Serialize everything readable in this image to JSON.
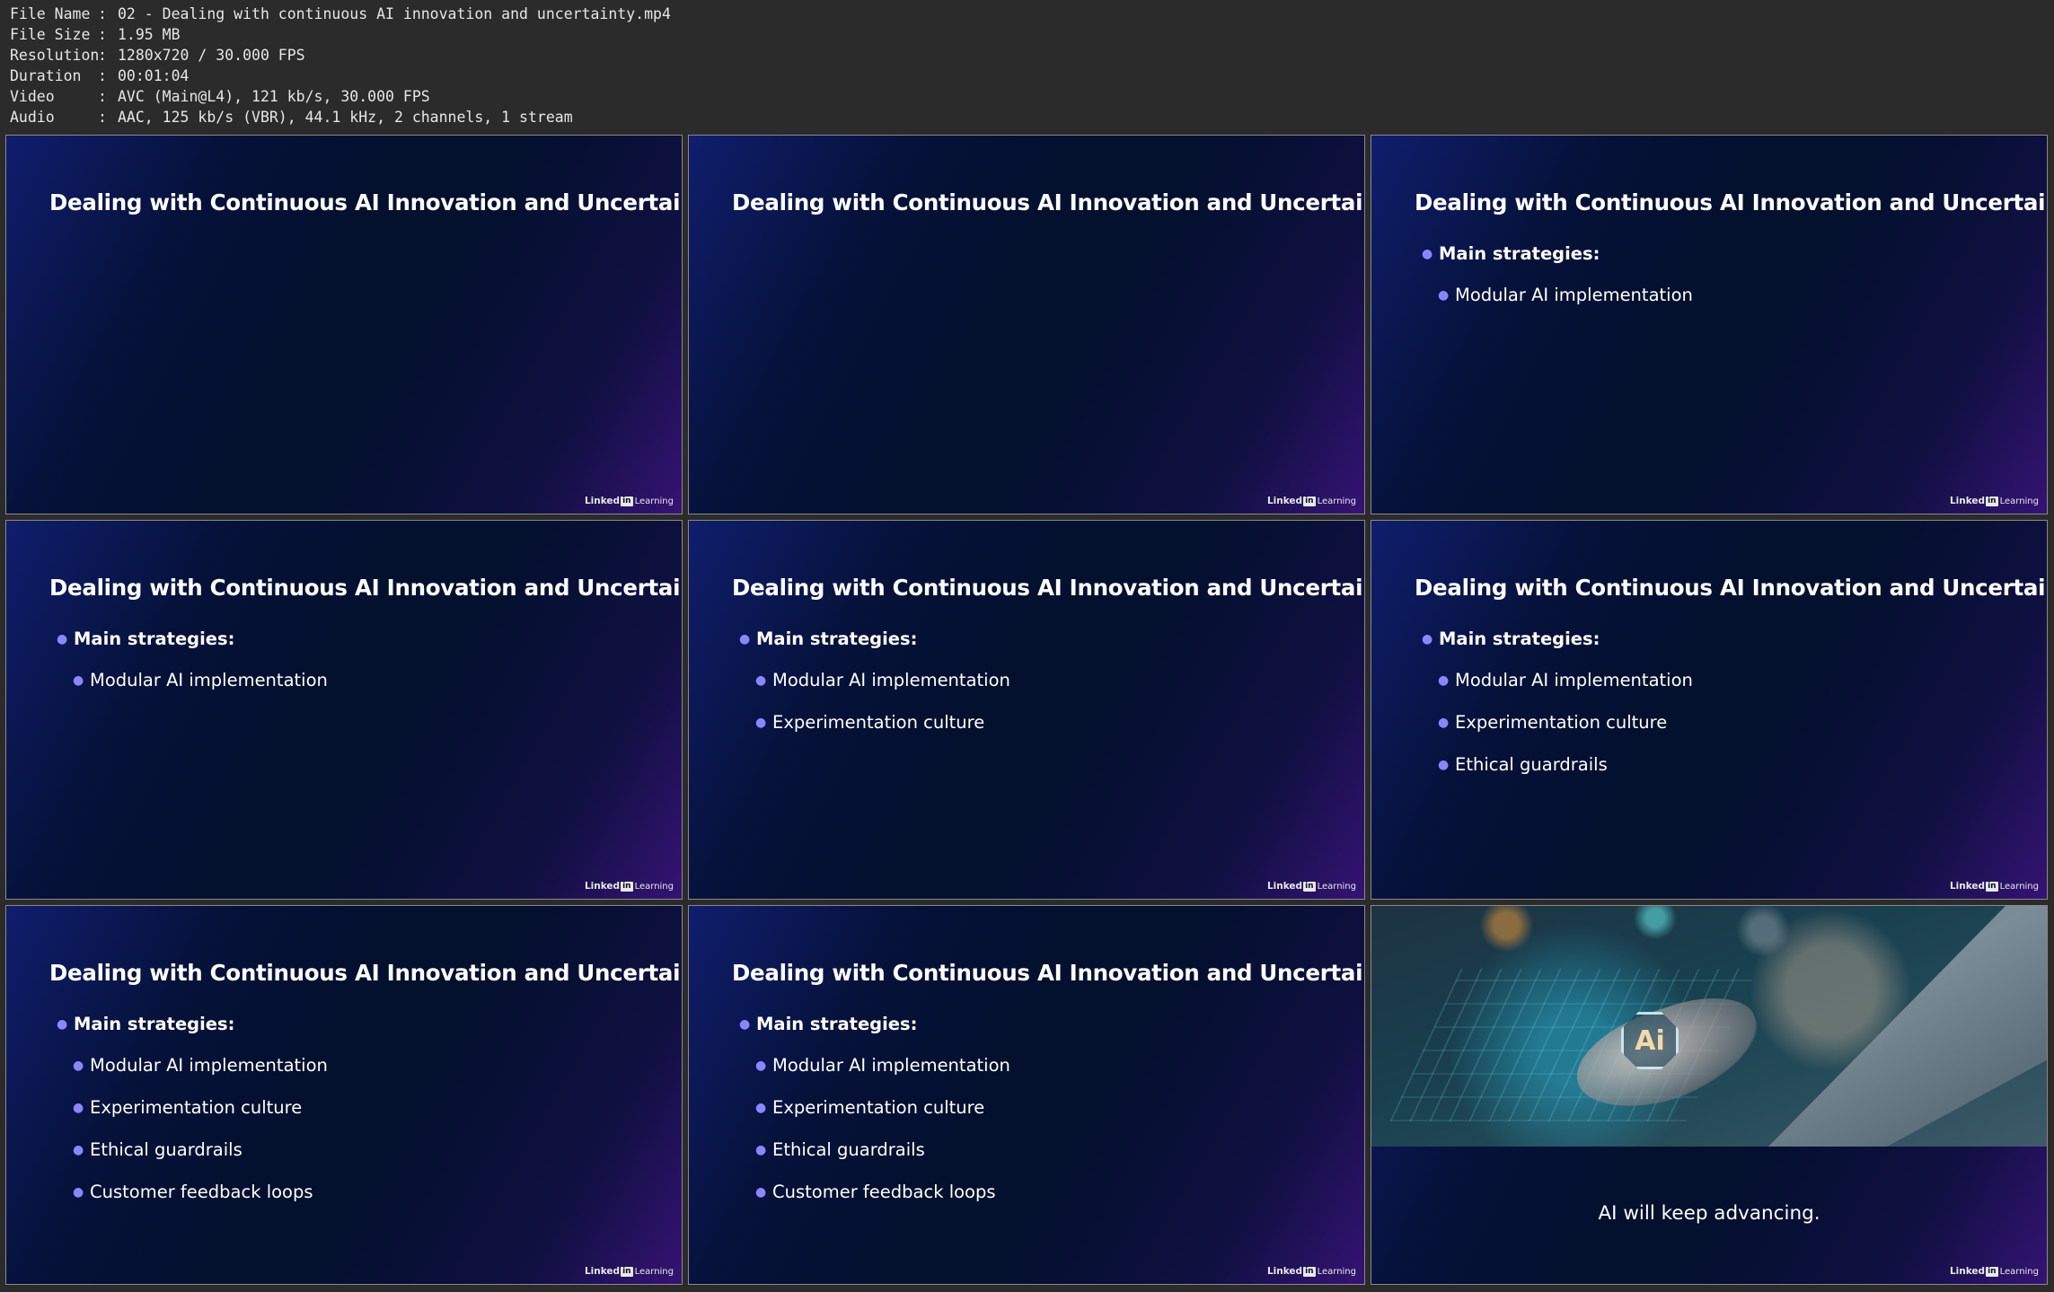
{
  "file_info": [
    {
      "key": "File Name",
      "value": "02 - Dealing with continuous AI innovation and uncertainty.mp4"
    },
    {
      "key": "File Size",
      "value": "1.95 MB"
    },
    {
      "key": "Resolution",
      "value": "1280x720 / 30.000 FPS"
    },
    {
      "key": "Duration",
      "value": "00:01:04"
    },
    {
      "key": "Video",
      "value": "AVC (Main@L4), 121 kb/s, 30.000 FPS"
    },
    {
      "key": "Audio",
      "value": "AAC, 125 kb/s (VBR), 44.1 kHz, 2 channels, 1 stream"
    }
  ],
  "separator": ":",
  "slide_title": "Dealing with Continuous AI Innovation and Uncertainty",
  "main_bullet": "Main strategies:",
  "sub_bullets": [
    "Modular AI implementation",
    "Experimentation culture",
    "Ethical guardrails",
    "Customer feedback loops"
  ],
  "logo": {
    "linked": "Linked",
    "in": "in",
    "learning": "Learning"
  },
  "final_slide": {
    "badge_text": "Ai",
    "caption": "AI will keep advancing."
  },
  "bullet_color": "#8a86ff"
}
